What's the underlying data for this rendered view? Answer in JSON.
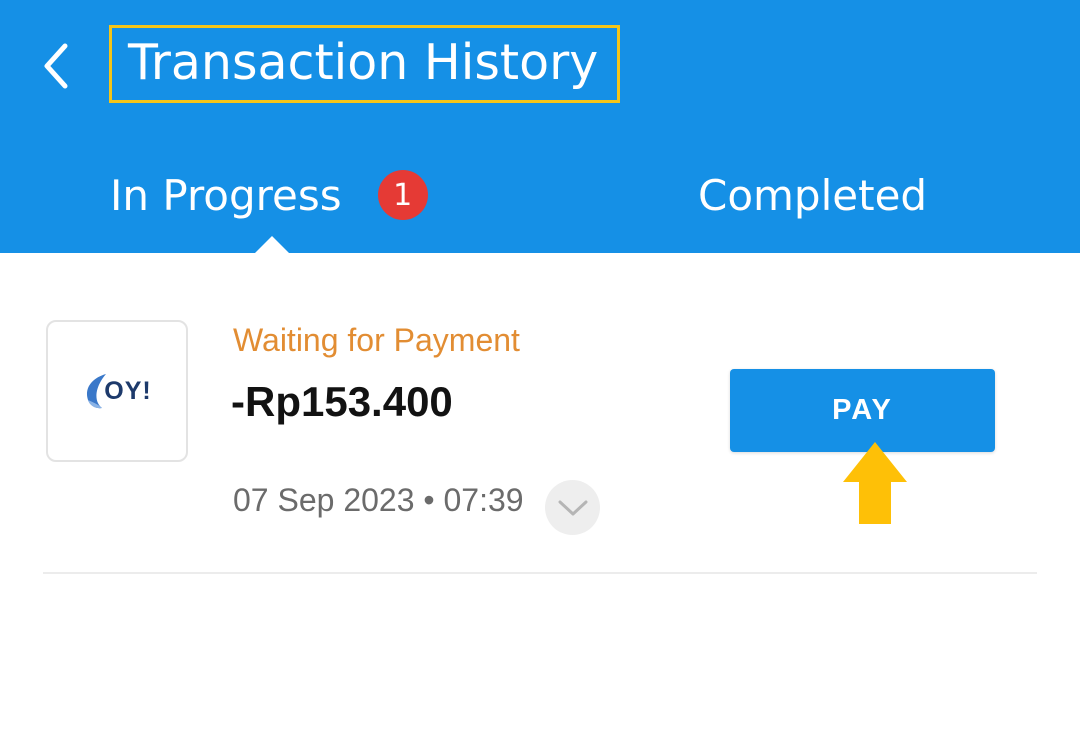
{
  "header": {
    "title": "Transaction History",
    "back_icon": "chevron-left-icon",
    "background_color": "#1590e6"
  },
  "tabs": [
    {
      "label": "In Progress",
      "badge": "1",
      "active": true
    },
    {
      "label": "Completed",
      "active": false
    }
  ],
  "transaction": {
    "logo_text": "OY!",
    "status": "Waiting for Payment",
    "amount": "-Rp153.400",
    "datetime": "07 Sep 2023 • 07:39",
    "expand_icon": "chevron-down-icon",
    "pay_label": "PAY"
  },
  "colors": {
    "accent": "#1590e6",
    "status": "#e28d33",
    "badge": "#e53a35",
    "highlight": "#f5c518"
  }
}
